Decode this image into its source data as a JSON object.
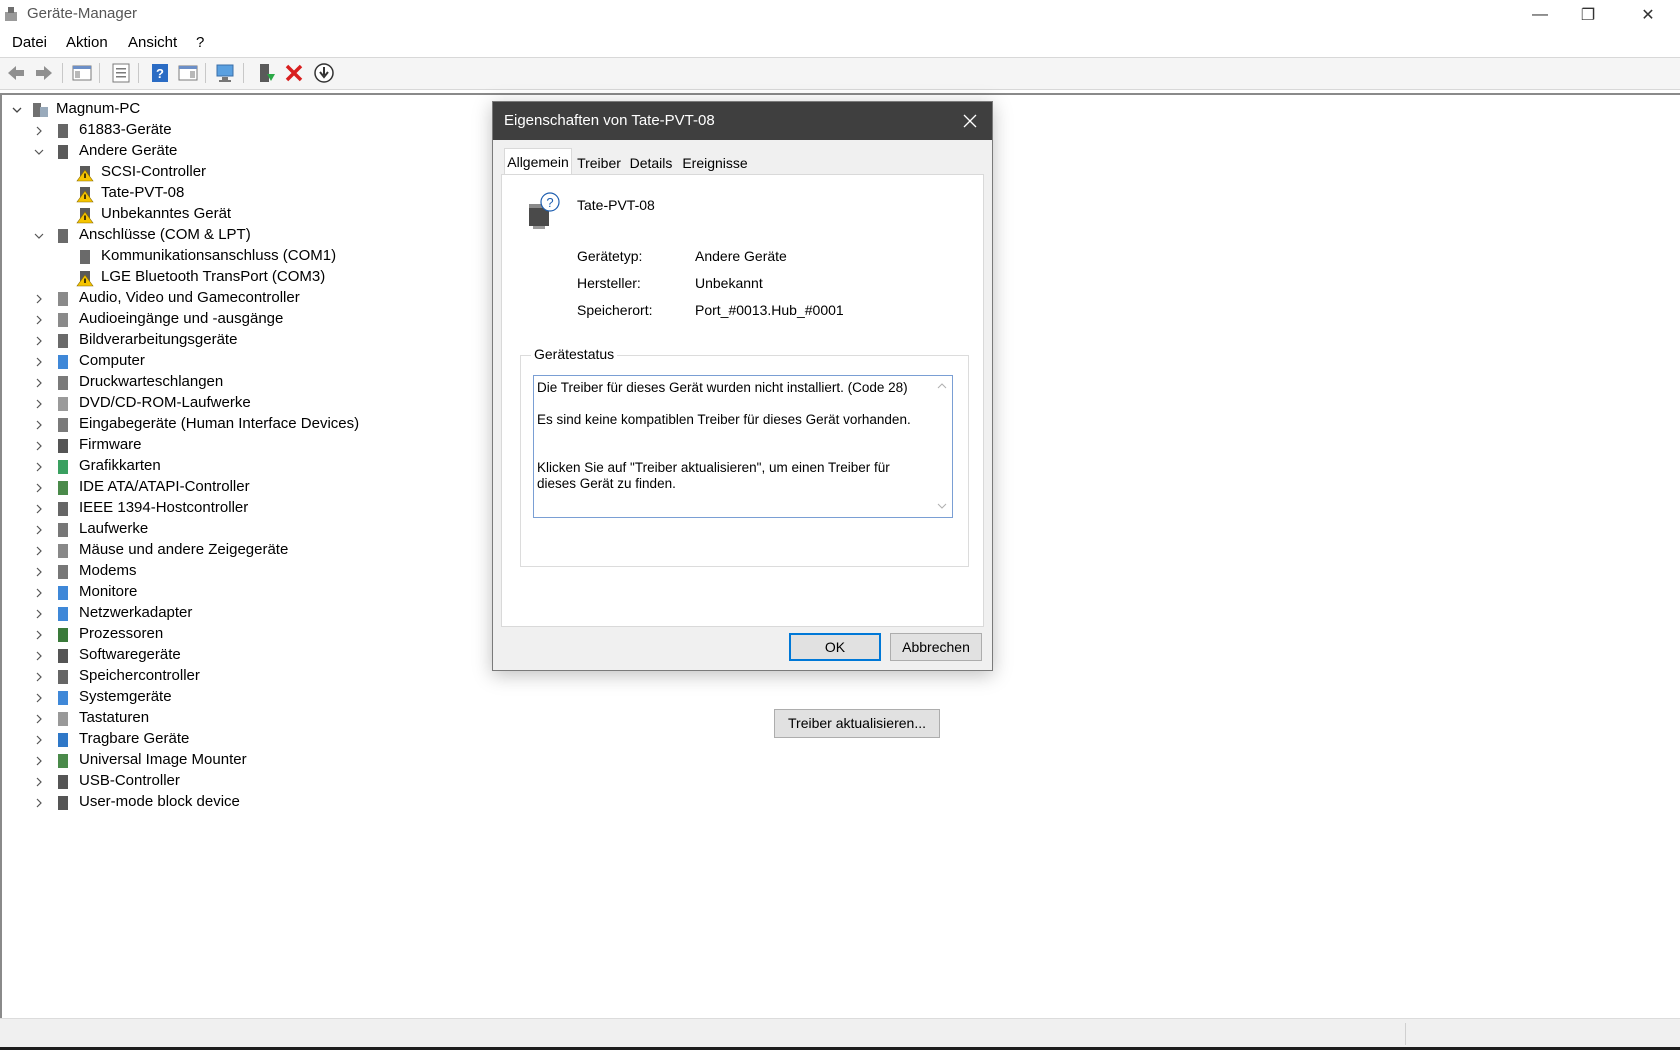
{
  "window": {
    "title": "Geräte-Manager",
    "icon": "device-manager-icon",
    "controls": {
      "minimize": "—",
      "maximize": "❐",
      "close": "✕"
    }
  },
  "menu": [
    "Datei",
    "Aktion",
    "Ansicht",
    "?"
  ],
  "toolbar": [
    {
      "name": "back-arrow-icon"
    },
    {
      "name": "forward-arrow-icon"
    },
    {
      "name": "show-hide-console-tree-icon"
    },
    {
      "name": "properties-icon"
    },
    {
      "name": "help-icon"
    },
    {
      "name": "show-action-pane-icon"
    },
    {
      "name": "scan-hardware-icon"
    },
    {
      "name": "update-driver-icon"
    },
    {
      "name": "uninstall-device-icon"
    },
    {
      "name": "download-icon"
    }
  ],
  "tree": {
    "root": "Magnum-PC",
    "items": [
      {
        "label": "61883-Geräte",
        "level": 1,
        "expander": "collapsed",
        "icon": "firewire-icon"
      },
      {
        "label": "Andere Geräte",
        "level": 1,
        "expander": "expanded",
        "icon": "unknown-device-icon"
      },
      {
        "label": "SCSI-Controller",
        "level": 2,
        "expander": "none",
        "icon": "warning-device-icon"
      },
      {
        "label": "Tate-PVT-08",
        "level": 2,
        "expander": "none",
        "icon": "warning-device-icon"
      },
      {
        "label": "Unbekanntes Gerät",
        "level": 2,
        "expander": "none",
        "icon": "warning-device-icon"
      },
      {
        "label": "Anschlüsse (COM & LPT)",
        "level": 1,
        "expander": "expanded",
        "icon": "port-icon"
      },
      {
        "label": "Kommunikationsanschluss (COM1)",
        "level": 2,
        "expander": "none",
        "icon": "port-icon"
      },
      {
        "label": "LGE Bluetooth TransPort (COM3)",
        "level": 2,
        "expander": "none",
        "icon": "warning-device-icon"
      },
      {
        "label": "Audio, Video und Gamecontroller",
        "level": 1,
        "expander": "collapsed",
        "icon": "speaker-icon"
      },
      {
        "label": "Audioeingänge und -ausgänge",
        "level": 1,
        "expander": "collapsed",
        "icon": "speaker-icon"
      },
      {
        "label": "Bildverarbeitungsgeräte",
        "level": 1,
        "expander": "collapsed",
        "icon": "camera-icon"
      },
      {
        "label": "Computer",
        "level": 1,
        "expander": "collapsed",
        "icon": "monitor-icon"
      },
      {
        "label": "Druckwarteschlangen",
        "level": 1,
        "expander": "collapsed",
        "icon": "printer-icon"
      },
      {
        "label": "DVD/CD-ROM-Laufwerke",
        "level": 1,
        "expander": "collapsed",
        "icon": "disc-drive-icon"
      },
      {
        "label": "Eingabegeräte (Human Interface Devices)",
        "level": 1,
        "expander": "collapsed",
        "icon": "hid-icon"
      },
      {
        "label": "Firmware",
        "level": 1,
        "expander": "collapsed",
        "icon": "chip-icon"
      },
      {
        "label": "Grafikkarten",
        "level": 1,
        "expander": "collapsed",
        "icon": "display-adapter-icon"
      },
      {
        "label": "IDE ATA/ATAPI-Controller",
        "level": 1,
        "expander": "collapsed",
        "icon": "controller-icon"
      },
      {
        "label": "IEEE 1394-Hostcontroller",
        "level": 1,
        "expander": "collapsed",
        "icon": "firewire-icon"
      },
      {
        "label": "Laufwerke",
        "level": 1,
        "expander": "collapsed",
        "icon": "disk-drive-icon"
      },
      {
        "label": "Mäuse und andere Zeigegeräte",
        "level": 1,
        "expander": "collapsed",
        "icon": "mouse-icon"
      },
      {
        "label": "Modems",
        "level": 1,
        "expander": "collapsed",
        "icon": "modem-icon"
      },
      {
        "label": "Monitore",
        "level": 1,
        "expander": "collapsed",
        "icon": "monitor-icon"
      },
      {
        "label": "Netzwerkadapter",
        "level": 1,
        "expander": "collapsed",
        "icon": "network-icon"
      },
      {
        "label": "Prozessoren",
        "level": 1,
        "expander": "collapsed",
        "icon": "processor-icon"
      },
      {
        "label": "Softwaregeräte",
        "level": 1,
        "expander": "collapsed",
        "icon": "software-device-icon"
      },
      {
        "label": "Speichercontroller",
        "level": 1,
        "expander": "collapsed",
        "icon": "storage-controller-icon"
      },
      {
        "label": "Systemgeräte",
        "level": 1,
        "expander": "collapsed",
        "icon": "system-device-icon"
      },
      {
        "label": "Tastaturen",
        "level": 1,
        "expander": "collapsed",
        "icon": "keyboard-icon"
      },
      {
        "label": "Tragbare Geräte",
        "level": 1,
        "expander": "collapsed",
        "icon": "portable-device-icon"
      },
      {
        "label": "Universal Image Mounter",
        "level": 1,
        "expander": "collapsed",
        "icon": "controller-icon"
      },
      {
        "label": "USB-Controller",
        "level": 1,
        "expander": "collapsed",
        "icon": "usb-icon"
      },
      {
        "label": "User-mode block device",
        "level": 1,
        "expander": "collapsed",
        "icon": "block-device-icon"
      }
    ]
  },
  "dialog": {
    "title": "Eigenschaften von Tate-PVT-08",
    "tabs": [
      "Allgemein",
      "Treiber",
      "Details",
      "Ereignisse"
    ],
    "active_tab": "Allgemein",
    "device_name": "Tate-PVT-08",
    "properties": [
      {
        "label": "Gerätetyp:",
        "value": "Andere Geräte"
      },
      {
        "label": "Hersteller:",
        "value": "Unbekannt"
      },
      {
        "label": "Speicherort:",
        "value": "Port_#0013.Hub_#0001"
      }
    ],
    "status_group_title": "Gerätestatus",
    "status_lines": [
      "Die Treiber für dieses Gerät wurden nicht installiert. (Code 28)",
      "Es sind keine kompatiblen Treiber für dieses Gerät vorhanden.",
      "Klicken Sie auf \"Treiber aktualisieren\", um einen Treiber für dieses Gerät zu finden."
    ],
    "update_button": "Treiber aktualisieren...",
    "ok_button": "OK",
    "cancel_button": "Abbrechen"
  },
  "colors": {
    "dialog_title_bg": "#3f3f3f",
    "warning": "#f5c400",
    "uninstall_red": "#d81e1e",
    "focus_blue": "#0078d7"
  }
}
